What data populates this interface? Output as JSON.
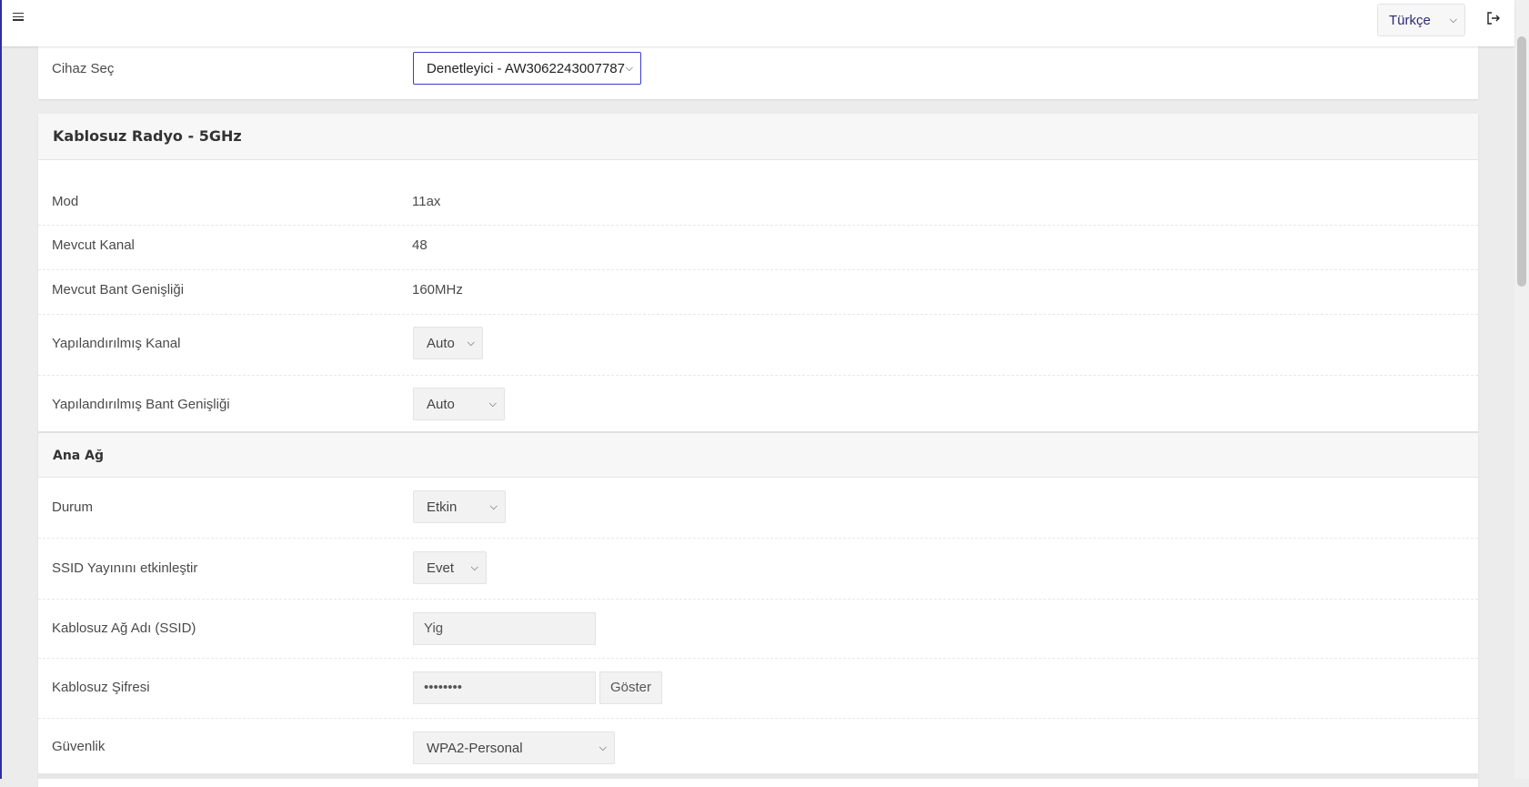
{
  "header": {
    "menu_icon": "hamburger-menu-icon",
    "language_selected": "Türkçe",
    "logout_icon": "logout-icon"
  },
  "device": {
    "label": "Cihaz Seç",
    "selected": "Denetleyici - AW3062243007787"
  },
  "radio": {
    "title": "Kablosuz Radyo - 5GHz",
    "mode": {
      "label": "Mod",
      "value": "11ax"
    },
    "current_channel": {
      "label": "Mevcut Kanal",
      "value": "48"
    },
    "current_bandwidth": {
      "label": "Mevcut Bant Genişliği",
      "value": "160MHz"
    },
    "configured_channel": {
      "label": "Yapılandırılmış Kanal",
      "selected": "Auto"
    },
    "configured_bandwidth": {
      "label": "Yapılandırılmış Bant Genişliği",
      "selected": "Auto"
    }
  },
  "main_network": {
    "title": "Ana Ağ",
    "status": {
      "label": "Durum",
      "selected": "Etkin"
    },
    "ssid_broadcast": {
      "label": "SSID Yayınını etkinleştir",
      "selected": "Evet"
    },
    "ssid": {
      "label": "Kablosuz Ağ Adı (SSID)",
      "value": "Yig"
    },
    "password": {
      "label": "Kablosuz Şifresi",
      "value": "••••••••",
      "show_button": "Göster"
    },
    "security": {
      "label": "Güvenlik",
      "selected": "WPA2-Personal"
    }
  },
  "colors": {
    "accent": "#3c3cc8",
    "background": "#ececec"
  }
}
